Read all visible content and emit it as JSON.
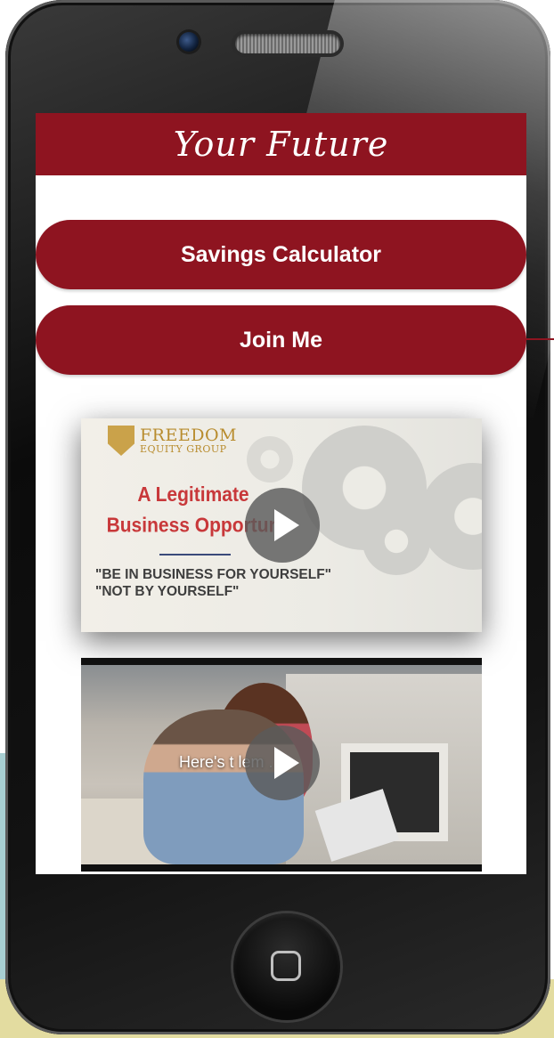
{
  "app": {
    "header_title": "Your Future"
  },
  "buttons": {
    "savings_calculator": "Savings Calculator",
    "join_me": "Join Me"
  },
  "video_1": {
    "logo_line1": "FREEDOM",
    "logo_line2": "EQUITY GROUP",
    "headline_line1": "A Legitimate",
    "headline_line2": "Business Opportun",
    "quote_line1": "\"BE IN BUSINESS FOR YOURSELF\"",
    "quote_line2": "\"NOT BY YOURSELF\"",
    "icon": "play-icon"
  },
  "video_2": {
    "caption": "Here's t       lem . . .",
    "icon": "play-icon"
  },
  "colors": {
    "brand_red": "#8e1420",
    "headline_red": "#c8383a",
    "logo_gold": "#b88c2e"
  }
}
